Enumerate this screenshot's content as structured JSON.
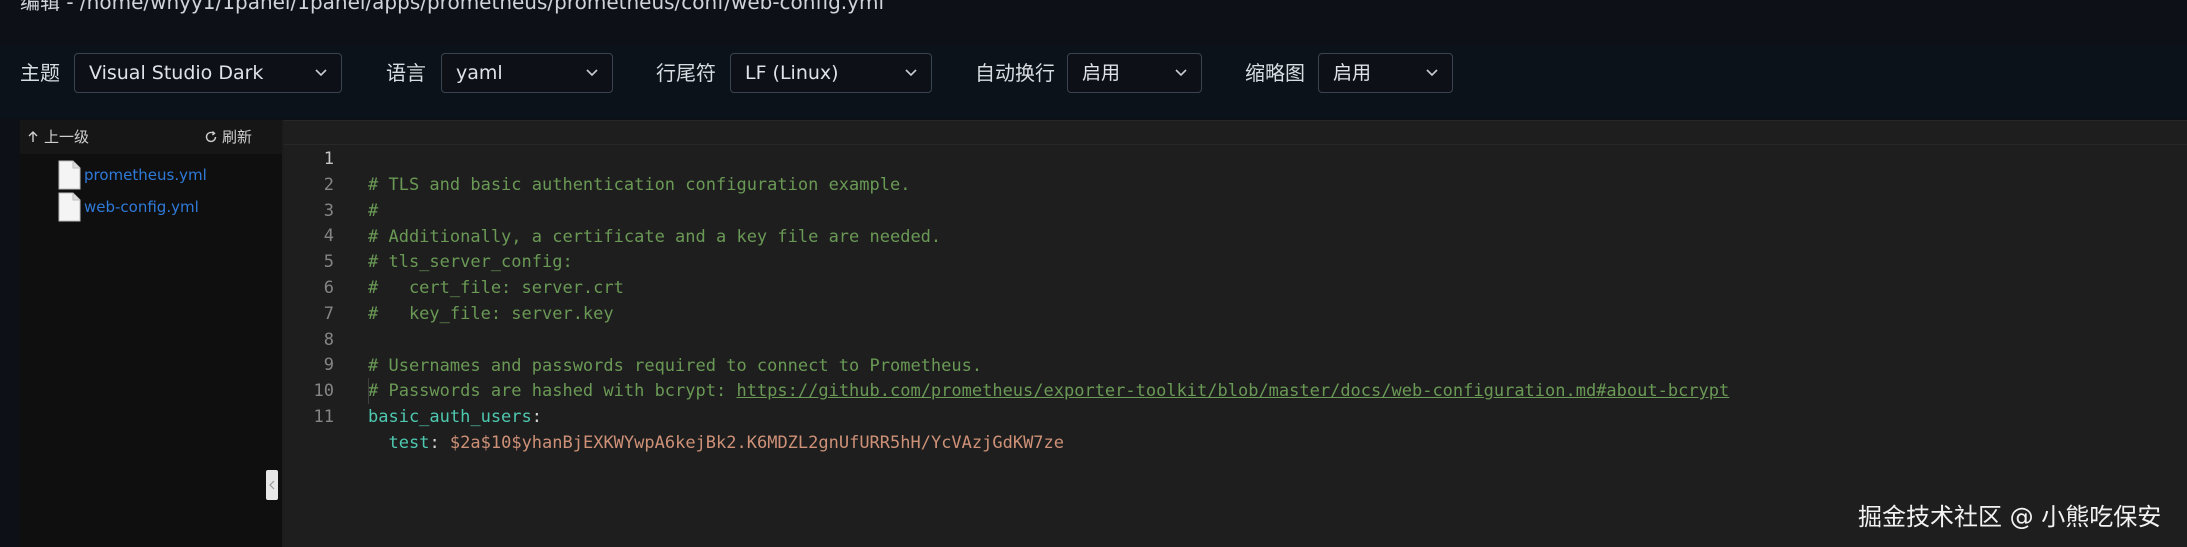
{
  "window": {
    "title": "编辑 - /home/whyy1/1panel/1panel/apps/prometheus/prometheus/conf/web-config.yml"
  },
  "toolbar": {
    "theme": {
      "label": "主题",
      "value": "Visual Studio Dark"
    },
    "language": {
      "label": "语言",
      "value": "yaml"
    },
    "eol": {
      "label": "行尾符",
      "value": "LF (Linux)"
    },
    "wordwrap": {
      "label": "自动换行",
      "value": "启用"
    },
    "minimap": {
      "label": "缩略图",
      "value": "启用"
    }
  },
  "sidebar": {
    "up_label": "上一级",
    "refresh_label": "刷新",
    "files": [
      {
        "name": "prometheus.yml"
      },
      {
        "name": "web-config.yml"
      }
    ]
  },
  "editor": {
    "active_line": 1,
    "lines": [
      {
        "num": "1",
        "text": "# TLS and basic authentication configuration example."
      },
      {
        "num": "2",
        "text": "#"
      },
      {
        "num": "3",
        "text": "# Additionally, a certificate and a key file are needed."
      },
      {
        "num": "4",
        "text": "# tls_server_config:"
      },
      {
        "num": "5",
        "text": "#   cert_file: server.crt"
      },
      {
        "num": "6",
        "text": "#   key_file: server.key"
      },
      {
        "num": "7",
        "text": ""
      },
      {
        "num": "8",
        "text": "# Usernames and passwords required to connect to Prometheus."
      },
      {
        "num": "9",
        "prefix": "# Passwords are hashed with bcrypt: ",
        "link": "https://github.com/prometheus/exporter-toolkit/blob/master/docs/web-configuration.md#about-bcrypt"
      },
      {
        "num": "10",
        "key": "basic_auth_users",
        "colon": ":"
      },
      {
        "num": "11",
        "indent": "  ",
        "key": "test",
        "colon": ": ",
        "value": "$2a$10$yhanBjEXKWYwpA6kejBk2.K6MDZL2gnUfURR5hH/YcVAzjGdKW7ze"
      }
    ]
  },
  "watermark": "掘金技术社区 @ 小熊吃保安",
  "colors": {
    "comment": "#6a9955",
    "key": "#4ec9b0",
    "string": "#ce9178",
    "link": "#2f7ad8",
    "editor_bg": "#1e1e1e"
  }
}
